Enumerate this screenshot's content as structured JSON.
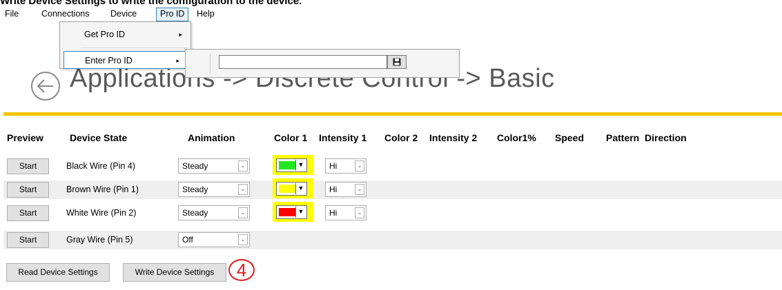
{
  "top_caption": "Write Device Settings to write the configuration to the device.",
  "menubar": {
    "items": [
      "File",
      "Connections",
      "Device",
      "Pro ID",
      "Help"
    ]
  },
  "pro_id_menu": {
    "items": [
      {
        "label": "Get Pro ID",
        "arrow": "▸"
      },
      {
        "label": "Enter Pro ID",
        "arrow": "▸"
      }
    ]
  },
  "enter_pro_id": {
    "value": "",
    "save_icon": "floppy-disk-icon"
  },
  "header": {
    "back_icon": "back-arrow-circle-icon",
    "title": "Applications -> Discrete Control -> Basic",
    "accent_color": "#f5c400"
  },
  "table": {
    "columns": [
      "Preview",
      "Device State",
      "Animation",
      "Color 1",
      "Intensity 1",
      "Color 2",
      "Intensity 2",
      "Color1%",
      "Speed",
      "Pattern",
      "Direction"
    ],
    "rows": [
      {
        "button": "Start",
        "state": "Black Wire (Pin 4)",
        "animation": "Steady",
        "color1": "#22e622",
        "intensity1": "Hi"
      },
      {
        "button": "Start",
        "state": "Brown Wire (Pin 1)",
        "animation": "Steady",
        "color1": "#ffff00",
        "intensity1": "Hi"
      },
      {
        "button": "Start",
        "state": "White Wire (Pin 2)",
        "animation": "Steady",
        "color1": "#ff0000",
        "intensity1": "Hi"
      },
      {
        "button": "Start",
        "state": "Gray Wire (Pin 5)",
        "animation": "Off",
        "color1": null,
        "intensity1": null
      }
    ]
  },
  "actions": {
    "read": "Read Device Settings",
    "write": "Write Device Settings",
    "step_marker": "4"
  }
}
